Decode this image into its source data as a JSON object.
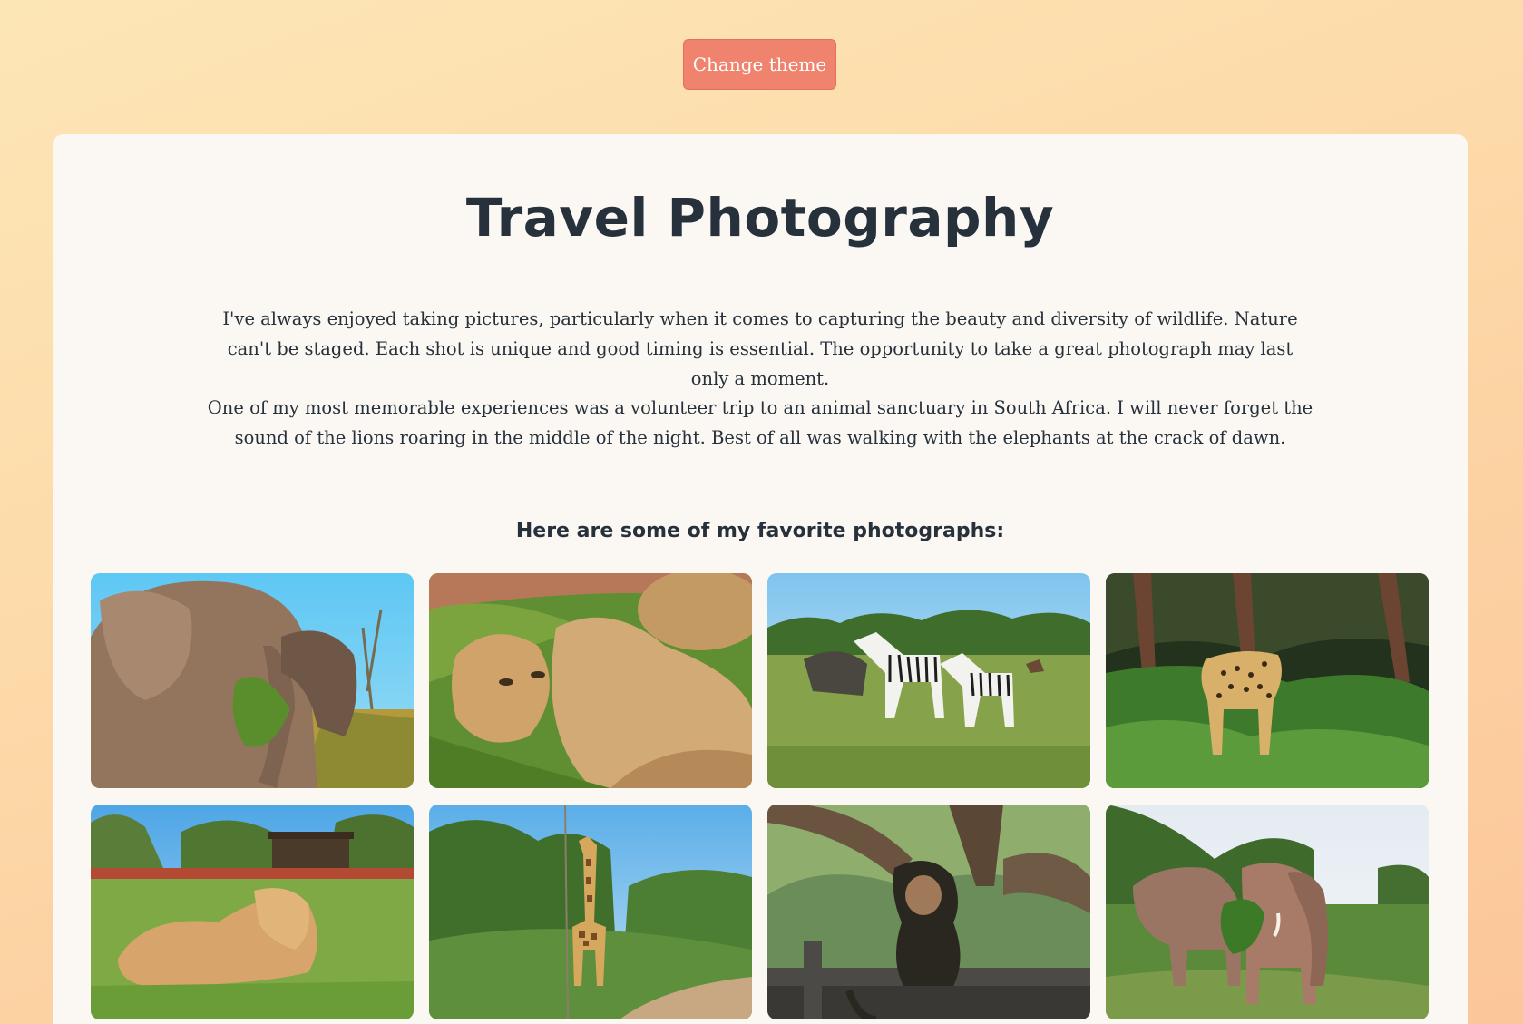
{
  "theme_button": {
    "label": "Change theme"
  },
  "page": {
    "title": "Travel Photography",
    "paragraphs": [
      "I've always enjoyed taking pictures, particularly when it comes to capturing the beauty and diversity of wildlife. Nature can't be staged. Each shot is unique and good timing is essential. The opportunity to take a great photograph may last only a moment.",
      "One of my most memorable experiences was a volunteer trip to an animal sanctuary in South Africa. I will never forget the sound of the lions roaring in the middle of the night. Best of all was walking with the elephants at the crack of dawn."
    ],
    "gallery_heading": "Here are some of my favorite photographs:"
  },
  "colors": {
    "button": "#f0836d",
    "card": "#fbf8f4",
    "text": "#27313b"
  },
  "gallery": [
    {
      "subject": "elephants eating leaves"
    },
    {
      "subject": "lionesses resting"
    },
    {
      "subject": "zebras and wildebeest on grassland"
    },
    {
      "subject": "leopard in forest"
    },
    {
      "subject": "lion lying on grass"
    },
    {
      "subject": "giraffe among trees"
    },
    {
      "subject": "monkey on wooden rail"
    },
    {
      "subject": "two elephants"
    }
  ]
}
